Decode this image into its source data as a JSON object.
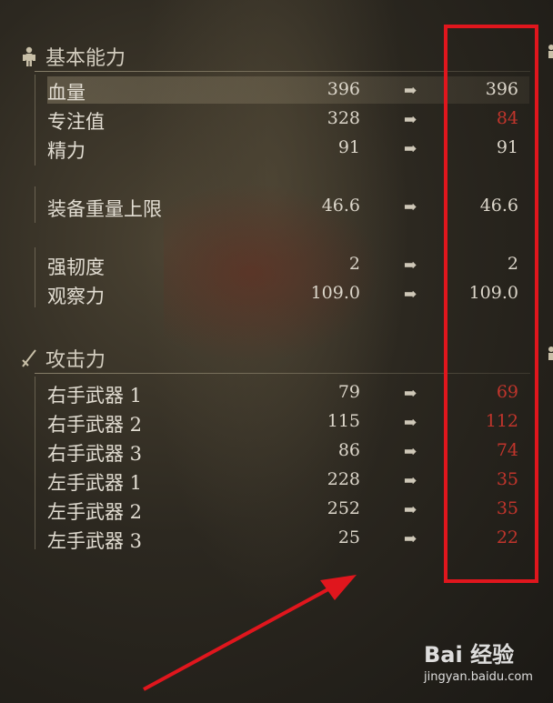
{
  "sections": {
    "basic": {
      "title": "基本能力",
      "rows": [
        {
          "label": "血量",
          "before": "396",
          "after": "396",
          "changed": false
        },
        {
          "label": "专注值",
          "before": "328",
          "after": "84",
          "changed": true
        },
        {
          "label": "精力",
          "before": "91",
          "after": "91",
          "changed": false
        },
        {
          "label": "装备重量上限",
          "before": "46.6",
          "after": "46.6",
          "changed": false
        },
        {
          "label": "强韧度",
          "before": "2",
          "after": "2",
          "changed": false
        },
        {
          "label": "观察力",
          "before": "109.0",
          "after": "109.0",
          "changed": false
        }
      ]
    },
    "attack": {
      "title": "攻击力",
      "rows": [
        {
          "label": "右手武器 1",
          "before": "79",
          "after": "69",
          "changed": true
        },
        {
          "label": "右手武器 2",
          "before": "115",
          "after": "112",
          "changed": true
        },
        {
          "label": "右手武器 3",
          "before": "86",
          "after": "74",
          "changed": true
        },
        {
          "label": "左手武器 1",
          "before": "228",
          "after": "35",
          "changed": true
        },
        {
          "label": "左手武器 2",
          "before": "252",
          "after": "35",
          "changed": true
        },
        {
          "label": "左手武器 3",
          "before": "25",
          "after": "22",
          "changed": true
        }
      ]
    }
  },
  "arrow_glyph": "➡",
  "watermark": {
    "brand": "Bai 经验",
    "url": "jingyan.baidu.com"
  },
  "colors": {
    "changed_value": "#c0352c",
    "annotation": "#e0161d"
  },
  "icons": {
    "basic": "body-figure-icon",
    "attack": "sword-icon"
  }
}
